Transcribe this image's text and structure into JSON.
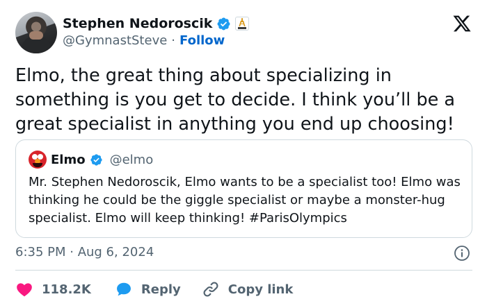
{
  "author": {
    "display_name": "Stephen Nedoroscik",
    "handle": "@GymnastSteve",
    "separator": "·",
    "follow_label": "Follow"
  },
  "tweet": {
    "text": "Elmo, the great thing about specializing in something is you get to decide. I think you’ll be a great specialist in anything you end up choosing!",
    "timestamp": "6:35 PM · Aug 6, 2024"
  },
  "quoted": {
    "display_name": "Elmo",
    "handle": "@elmo",
    "text": "Mr. Stephen Nedoroscik, Elmo wants to be a specialist too! Elmo was thinking he could be the giggle specialist or maybe a monster-hug specialist. Elmo will keep thinking! #ParisOlympics"
  },
  "actions": {
    "likes": "118.2K",
    "reply_label": "Reply",
    "copy_link_label": "Copy link"
  },
  "icons": {
    "brand": "x-logo-icon",
    "verified": "verified-badge-icon",
    "affiliate": "eiffel-tower-badge-icon",
    "info": "info-icon",
    "like": "heart-icon",
    "reply": "speech-bubble-icon",
    "copy": "link-icon"
  },
  "colors": {
    "text": "#0f1419",
    "secondary": "#536471",
    "link": "#0066cc",
    "verified": "#1d9bf0",
    "like": "#f91880",
    "reply": "#1d9bf0",
    "border": "#cfd9de"
  }
}
